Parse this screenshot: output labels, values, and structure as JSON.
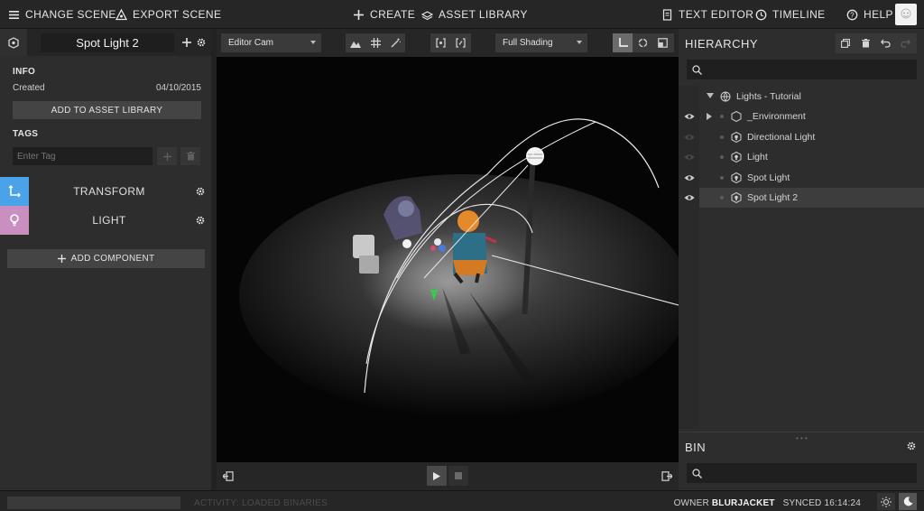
{
  "topbar": {
    "change_scene": "CHANGE SCENE",
    "export_scene": "EXPORT SCENE",
    "create": "CREATE",
    "asset_library": "ASSET LIBRARY",
    "text_editor": "TEXT EDITOR",
    "timeline": "TIMELINE",
    "help": "HELP"
  },
  "inspector": {
    "entity_name": "Spot Light 2",
    "info_label": "INFO",
    "created_label": "Created",
    "created_value": "04/10/2015",
    "add_to_library": "ADD TO ASSET LIBRARY",
    "tags_label": "TAGS",
    "tag_placeholder": "Enter Tag",
    "components": [
      {
        "label": "TRANSFORM",
        "color": "#4aa3e8"
      },
      {
        "label": "LIGHT",
        "color": "#c98fc0"
      }
    ],
    "add_component": "ADD COMPONENT"
  },
  "viewport_toolbar": {
    "camera": "Editor Cam",
    "shading": "Full Shading"
  },
  "hierarchy": {
    "title": "HIERARCHY",
    "items": [
      {
        "label": "Lights - Tutorial",
        "icon": "globe-icon"
      },
      {
        "label": "_Environment",
        "icon": "hexagon-icon"
      },
      {
        "label": "Directional Light",
        "icon": "light-entity-icon"
      },
      {
        "label": "Light",
        "icon": "light-entity-icon"
      },
      {
        "label": "Spot Light",
        "icon": "light-entity-icon"
      },
      {
        "label": "Spot Light 2",
        "icon": "light-entity-icon",
        "selected": true
      }
    ]
  },
  "bin": {
    "title": "BIN"
  },
  "status": {
    "activity": "ACTIVITY: LOADED BINARIES",
    "owner_label": "OWNER",
    "owner_name": "BLURJACKET",
    "synced_label": "SYNCED",
    "synced_time": "16:14:24"
  },
  "colors": {
    "accent_transform": "#4aa3e8",
    "accent_light": "#c98fc0",
    "background": "#2d2d2d"
  }
}
